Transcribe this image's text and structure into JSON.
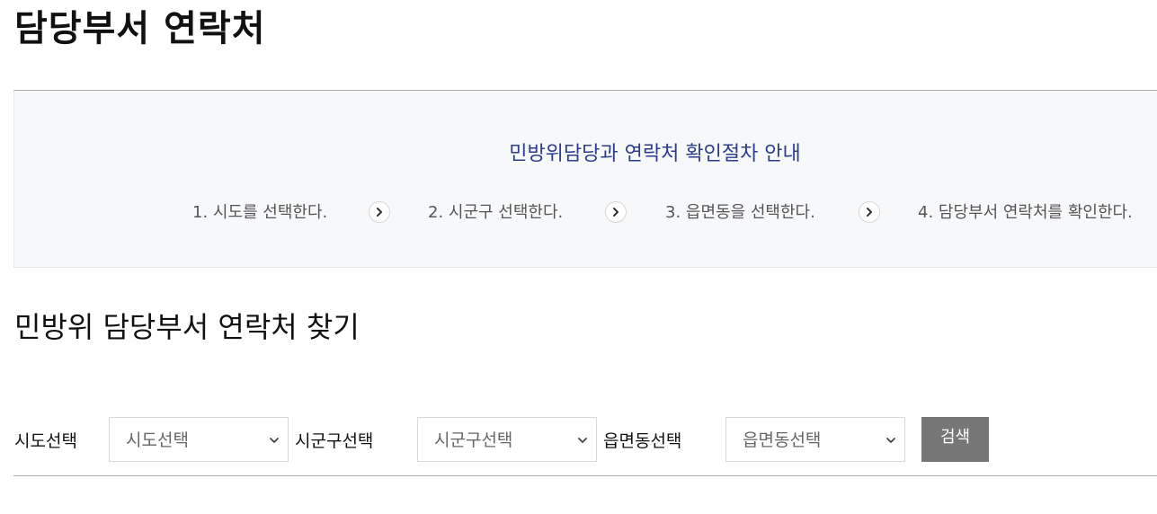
{
  "page": {
    "title": "담당부서 연락처"
  },
  "guide": {
    "title": "민방위담당과 연락처 확인절차 안내",
    "steps": [
      "1. 시도를 선택한다.",
      "2. 시군구 선택한다.",
      "3. 읍면동을 선택한다.",
      "4. 담당부서 연락처를 확인한다."
    ],
    "arrow_icon": "chevron-right-icon"
  },
  "search": {
    "title": "민방위 담당부서 연락처 찾기",
    "sido_label": "시도선택",
    "sido_value": "시도선택",
    "sigungu_label": "시군구선택",
    "sigungu_value": "시군구선택",
    "eupmyeondong_label": "읍면동선택",
    "eupmyeondong_value": "읍면동선택",
    "button_label": "검색",
    "button_color": "#777777"
  },
  "colors": {
    "guide_title": "#2b3d8c",
    "guide_background": "#f7f8fa"
  }
}
